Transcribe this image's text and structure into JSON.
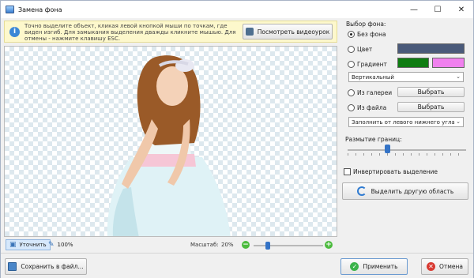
{
  "window": {
    "title": "Замена фона",
    "controls": {
      "minimize": "—",
      "maximize": "☐",
      "close": "✕"
    }
  },
  "info": {
    "icon": "info-icon",
    "text": "Точно выделите объект, кликая левой кнопкой мыши по точкам, где виден изгиб. Для замыкания выделения дважды кликните мышью. Для отмены - нажмите клавишу ESC.",
    "video_button": "Посмотреть видеоурок"
  },
  "canvas_tools": {
    "refine_label": "Уточнить",
    "feather_value": "100%",
    "zoom_label": "Масштаб:",
    "zoom_value": "20%",
    "zoom_level": 0.2,
    "zoom_minus": "−",
    "zoom_plus": "+"
  },
  "background_panel": {
    "heading": "Выбор фона:",
    "options": {
      "none": "Без фона",
      "color": "Цвет",
      "gradient": "Градиент",
      "gallery": "Из галереи",
      "file": "Из файла"
    },
    "selected": "none",
    "color_swatch": "#4a5a7a",
    "gradient_colors": [
      "#0f7d12",
      "#f080ee"
    ],
    "gradient_direction": "Вертикальный",
    "gallery_button": "Выбрать",
    "file_button": "Выбрать",
    "fill_mode": "Заполнить от левого нижнего угла"
  },
  "edge_blur": {
    "label": "Размытие границ:",
    "level": 0.33
  },
  "invert_selection_label": "Инвертировать выделение",
  "select_other_button": "Выделить другую область",
  "footer": {
    "save_button": "Сохранить в файл...",
    "apply_button": "Применить",
    "cancel_button": "Отмена"
  },
  "colors": {
    "accent": "#3473c6",
    "info_bg": "#fdf8cc",
    "ok": "#3bb34a",
    "cancel": "#d93a32"
  }
}
